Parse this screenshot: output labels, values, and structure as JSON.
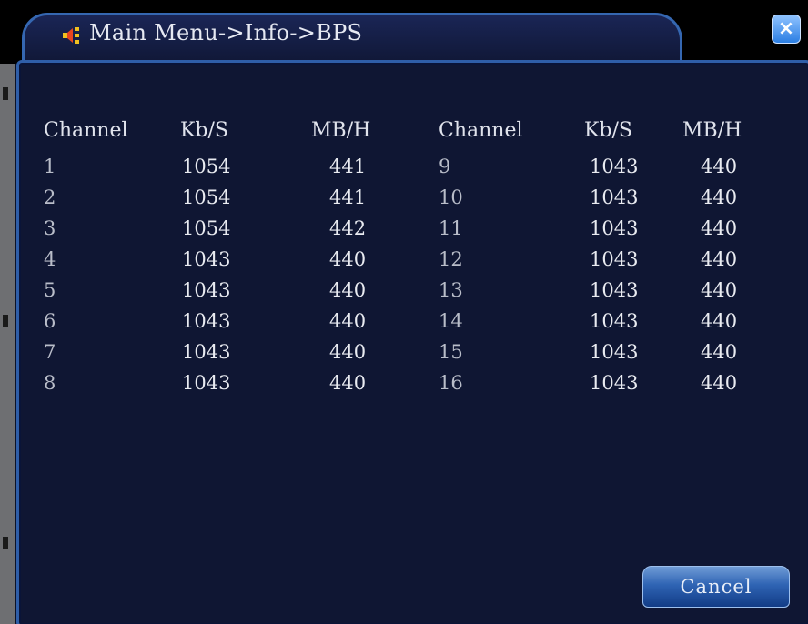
{
  "window": {
    "title": "Main Menu->Info->BPS",
    "close_label": "×"
  },
  "table": {
    "headers": [
      "Channel",
      "Kb/S",
      "MB/H",
      "Channel",
      "Kb/S",
      "MB/H"
    ],
    "rows": [
      [
        "1",
        "1054",
        "441",
        "9",
        "1043",
        "440"
      ],
      [
        "2",
        "1054",
        "441",
        "10",
        "1043",
        "440"
      ],
      [
        "3",
        "1054",
        "442",
        "11",
        "1043",
        "440"
      ],
      [
        "4",
        "1043",
        "440",
        "12",
        "1043",
        "440"
      ],
      [
        "5",
        "1043",
        "440",
        "13",
        "1043",
        "440"
      ],
      [
        "6",
        "1043",
        "440",
        "14",
        "1043",
        "440"
      ],
      [
        "7",
        "1043",
        "440",
        "15",
        "1043",
        "440"
      ],
      [
        "8",
        "1043",
        "440",
        "16",
        "1043",
        "440"
      ]
    ]
  },
  "buttons": {
    "cancel_label": "Cancel"
  },
  "colors": {
    "background": "#0f1633",
    "border": "#2f5ea8",
    "accent": "#2b7ee3"
  },
  "icons": {
    "title_icon": "speaker-icon",
    "close_icon": "close-icon"
  }
}
